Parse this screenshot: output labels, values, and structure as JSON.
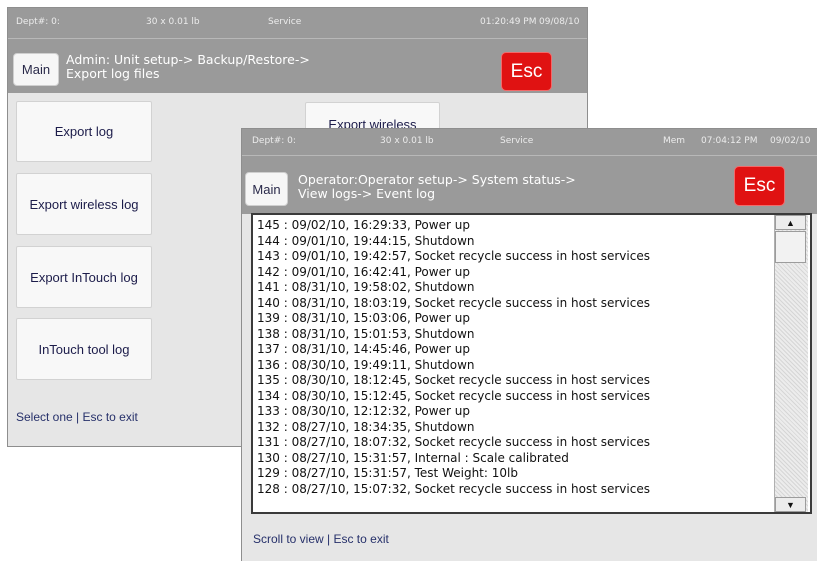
{
  "back_window": {
    "status": {
      "dept": "Dept#: 0:",
      "capacity": "30 x 0.01 lb",
      "mode": "Service",
      "time": "01:20:49 PM",
      "date": "09/08/10"
    },
    "main_label": "Main",
    "breadcrumb": [
      "Admin: Unit setup-> Backup/Restore->",
      "Export log files"
    ],
    "esc_label": "Esc",
    "buttons": {
      "export_log": "Export log",
      "export_wireless_log": "Export wireless log",
      "export_intouch_log": "Export InTouch log",
      "intouch_tool_log": "InTouch tool log",
      "export_wireless_partial": "Export wireless"
    },
    "footer": "Select one | Esc to exit"
  },
  "front_window": {
    "status": {
      "dept": "Dept#: 0:",
      "capacity": "30 x 0.01 lb",
      "mode": "Service",
      "mem": "Mem",
      "time": "07:04:12 PM",
      "date": "09/02/10"
    },
    "main_label": "Main",
    "breadcrumb": [
      "Operator:Operator setup-> System status->",
      "View logs-> Event log"
    ],
    "esc_label": "Esc",
    "log_entries": [
      "145 : 09/02/10, 16:29:33, Power up",
      "144 : 09/01/10, 19:44:15, Shutdown",
      "143 : 09/01/10, 19:42:57, Socket recycle success in host services",
      "142 : 09/01/10, 16:42:41, Power up",
      "141 : 08/31/10, 19:58:02, Shutdown",
      "140 : 08/31/10, 18:03:19, Socket recycle success in host services",
      "139 : 08/31/10, 15:03:06, Power up",
      "138 : 08/31/10, 15:01:53, Shutdown",
      "137 : 08/31/10, 14:45:46, Power up",
      "136 : 08/30/10, 19:49:11, Shutdown",
      "135 : 08/30/10, 18:12:45, Socket recycle success in host services",
      "134 : 08/30/10, 15:12:45, Socket recycle success in host services",
      "133 : 08/30/10, 12:12:32, Power up",
      "132 : 08/27/10, 18:34:35, Shutdown",
      "131 : 08/27/10, 18:07:32, Socket recycle success in host services",
      "130 : 08/27/10, 15:31:57, Internal : Scale calibrated",
      "129 : 08/27/10, 15:31:57, Test Weight: 10lb",
      "128 : 08/27/10, 15:07:32, Socket recycle success in host services"
    ],
    "scroll_up_glyph": "▲",
    "scroll_down_glyph": "▼",
    "footer": "Scroll to view | Esc to exit"
  },
  "colors": {
    "header_gray": "#9a9a9a",
    "panel_gray": "#e6e6e6",
    "esc_red": "#e01212",
    "footer_text": "#26306a"
  }
}
